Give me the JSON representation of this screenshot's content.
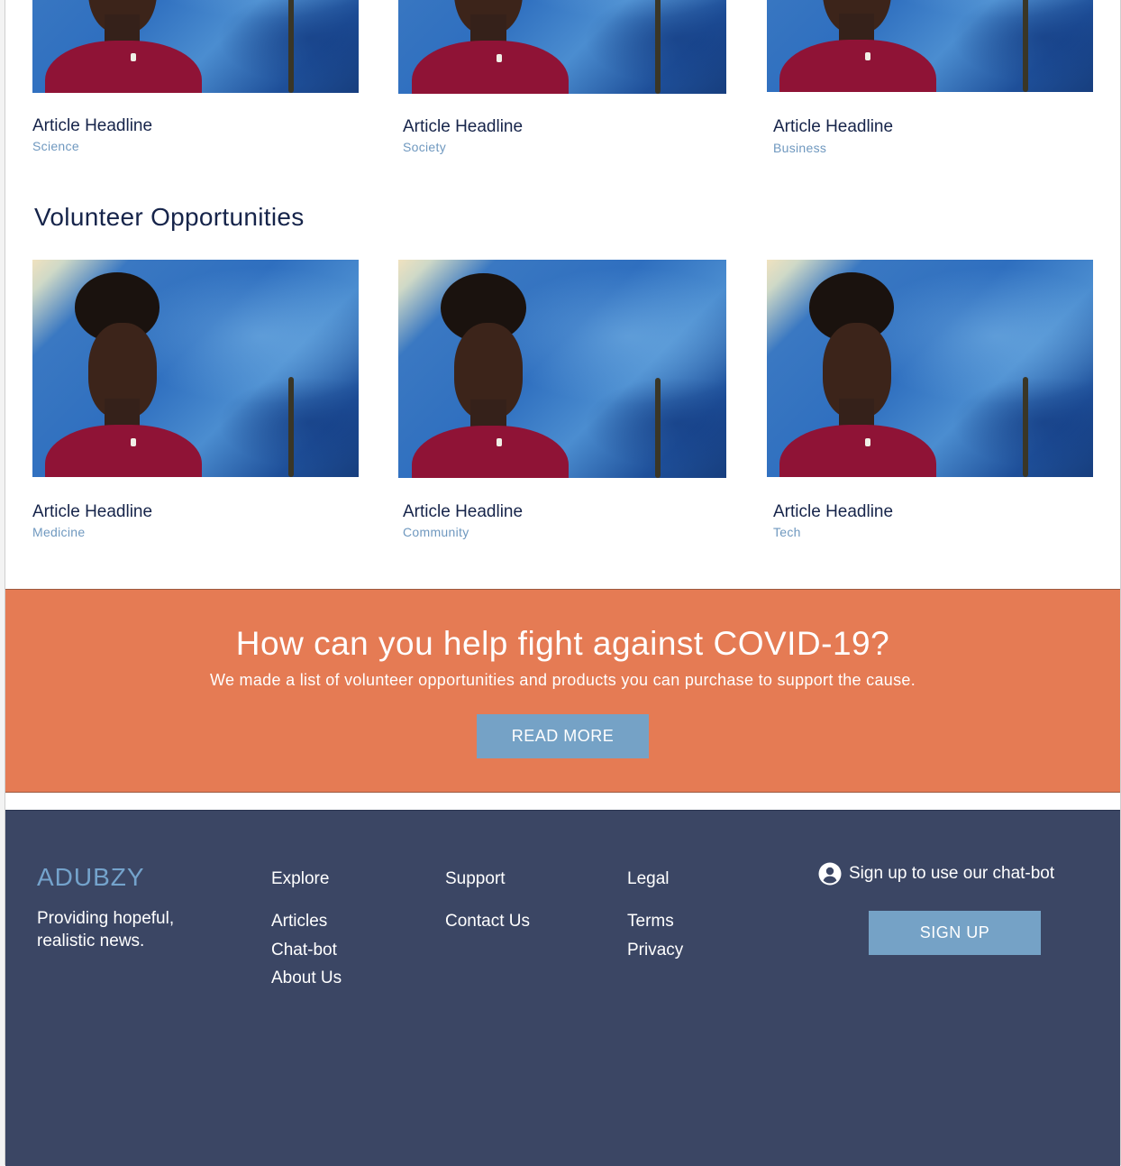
{
  "top_articles": [
    {
      "headline": "Article Headline",
      "category": "Science"
    },
    {
      "headline": "Article Headline",
      "category": "Society"
    },
    {
      "headline": "Article Headline",
      "category": "Business"
    }
  ],
  "volunteer": {
    "title": "Volunteer Opportunities",
    "articles": [
      {
        "headline": "Article Headline",
        "category": "Medicine"
      },
      {
        "headline": "Article Headline",
        "category": "Community"
      },
      {
        "headline": "Article Headline",
        "category": "Tech"
      }
    ]
  },
  "cta": {
    "title": "How can you help fight against COVID-19?",
    "subtitle": "We made a list of volunteer opportunities and products you can purchase to support the cause.",
    "button_label": "READ MORE"
  },
  "footer": {
    "brand": "ADUBZY",
    "tagline": "Providing hopeful, realistic news.",
    "explore": {
      "heading": "Explore",
      "links": [
        "Articles",
        "Chat-bot",
        "About Us"
      ]
    },
    "support": {
      "heading": "Support",
      "links": [
        "Contact Us"
      ]
    },
    "legal": {
      "heading": "Legal",
      "links": [
        "Terms",
        "Privacy"
      ]
    },
    "chatbot": {
      "text": "Sign up to use our chat-bot",
      "icon": "account-circle-icon",
      "button_label": "SIGN UP"
    }
  },
  "colors": {
    "navy_text": "#16244a",
    "category_blue": "#6f98bf",
    "cta_orange": "#e57b54",
    "button_blue": "#75a2c6",
    "footer_bg": "#3b4664"
  }
}
